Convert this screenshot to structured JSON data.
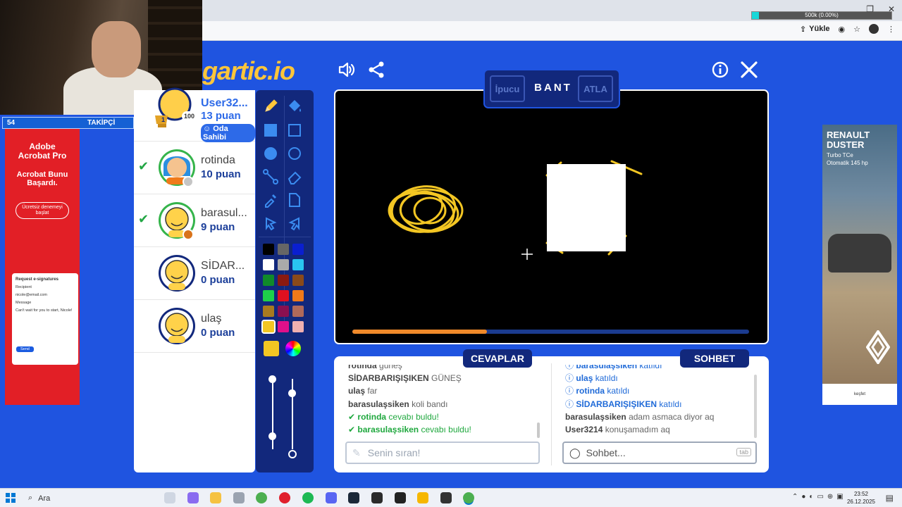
{
  "browser": {
    "upload_status": "500k (0.00%)",
    "upload_button": "Yükle"
  },
  "stream_overlay": {
    "follower_count": "54",
    "follower_label": "TAKİPÇİ"
  },
  "ad_left": {
    "brand": "Adobe Acrobat Pro",
    "headline": "Acrobat Bunu Başardı.",
    "cta": "Ücretsiz denemeyi başlat",
    "form_title": "Request e-signatures",
    "form_recipient_label": "Recipient",
    "form_email": "nicole@email.com",
    "form_message_label": "Message",
    "form_message": "Can't wait for you to start, Nicole!",
    "form_send": "Send"
  },
  "game": {
    "logo": "gartic.io",
    "word_hint_button": "İpucu",
    "word": "BANT",
    "skip_button": "ATLA",
    "timer_fraction": 0.34
  },
  "players": [
    {
      "name": "User32...",
      "score": "13 puan",
      "badge": "Oda Sahibi",
      "crown_number": "100"
    },
    {
      "name": "rotinda",
      "score": "10 puan",
      "guessed": true
    },
    {
      "name": "barasul...",
      "score": "9 puan",
      "guessed": true
    },
    {
      "name": "SİDAR...",
      "score": "0 puan"
    },
    {
      "name": "ulaş",
      "score": "0 puan"
    }
  ],
  "answers": {
    "tab": "CEVAPLAR",
    "messages": [
      {
        "user": "rotinda",
        "text": "güneş"
      },
      {
        "user": "SİDARBARIŞIŞIKEN",
        "text": "GÜNEŞ"
      },
      {
        "user": "ulaş",
        "text": "far"
      },
      {
        "user": "barasulaşsiken",
        "text": "koli bandı"
      }
    ],
    "found": [
      {
        "user": "rotinda",
        "text": "cevabı buldu!"
      },
      {
        "user": "barasulaşsiken",
        "text": "cevabı buldu!"
      }
    ],
    "input_placeholder": "Senin sıran!"
  },
  "chat": {
    "tab": "SOHBET",
    "joins": [
      {
        "user": "barasulaşsiken",
        "text": "katıldı"
      },
      {
        "user": "ulaş",
        "text": "katıldı"
      },
      {
        "user": "rotinda",
        "text": "katıldı"
      },
      {
        "user": "SİDARBARIŞIŞIKEN",
        "text": "katıldı"
      }
    ],
    "messages": [
      {
        "user": "barasulaşsiken",
        "text": "adam asmaca diyor aq"
      },
      {
        "user": "User3214",
        "text": "konuşamadım aq"
      }
    ],
    "input_placeholder": "Sohbet...",
    "input_hint": "tab"
  },
  "ad_right": {
    "brand": "RENAULT DUSTER",
    "sub1": "Turbo TCe",
    "sub2": "Otomatik 145 hp",
    "footer": "keşfet"
  },
  "taskbar": {
    "search": "Ara",
    "time": "23:52",
    "date": "26.12.2025"
  },
  "colors": {
    "page_bg": "#1f54e0",
    "panel_navy": "#12287c",
    "accent_yellow": "#ffc63a",
    "brush_yellow": "#f3c623",
    "timer_orange": "#f08a2a",
    "guess_green": "#1fa83e",
    "info_blue": "#1f6ad8"
  }
}
